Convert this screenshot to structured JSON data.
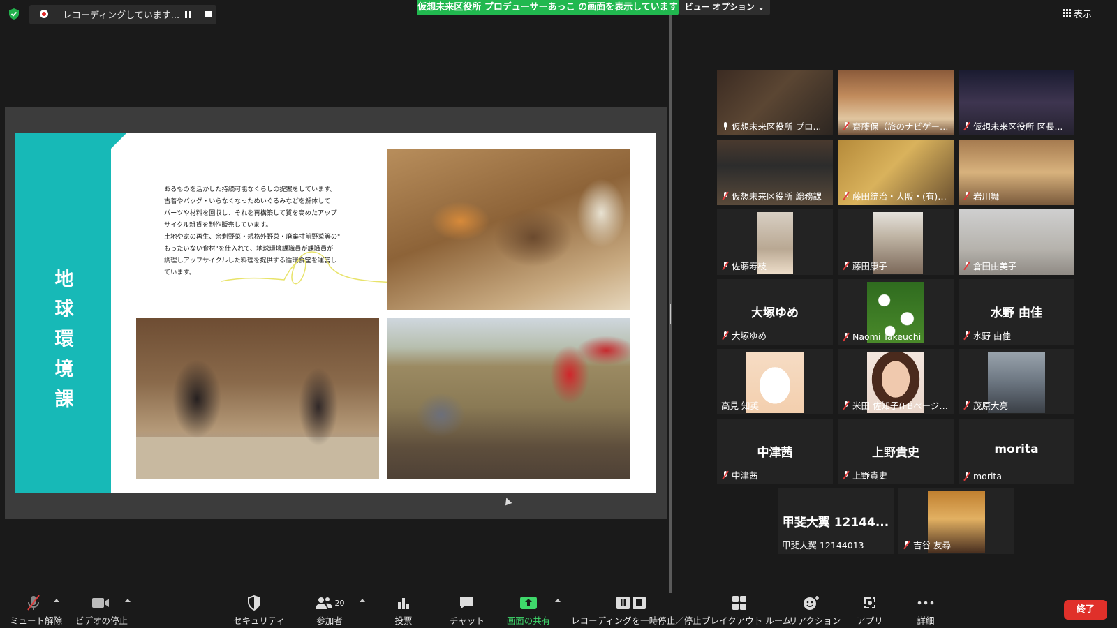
{
  "recording": {
    "status_text": "レコーディングしています..."
  },
  "share_banner": "仮想未来区役所 プロデューサーあっこ の画面を表示しています",
  "view_options": "ビュー オプション ⌄",
  "view_button": "表示",
  "slide": {
    "title": "地球環境課",
    "body": "あるものを活かした持続可能なくらしの提案をしています。\n古着やバッグ・いらなくなったぬいぐるみなどを解体して\nパーツや材料を回収し、それを再構築して質を高めたアップ\nサイクル雑貨を制作販売しています。\n土地や家の再生、余剰野菜・規格外野菜・廃棄寸前野菜等の\"\nもったいない食材\"を仕入れて、地球環境課職員が課職員が\n調理しアップサイクルした料理を提供する循環食堂を運営し\nています。",
    "accent_color": "#17b9b7"
  },
  "participants": [
    {
      "name": "仮想未来区役所 プロ...",
      "muted": false,
      "active": true,
      "video": true
    },
    {
      "name": "齋藤保（旅のナビゲータ...",
      "muted": true,
      "video": true
    },
    {
      "name": "仮想未来区役所 区長...",
      "muted": true,
      "video": true
    },
    {
      "name": "仮想未来区役所 総務課",
      "muted": true,
      "video": true
    },
    {
      "name": "藤田統治・大阪・(有)リア...",
      "muted": true,
      "video": true
    },
    {
      "name": "岩川舞",
      "muted": true,
      "video": true
    },
    {
      "name": "佐藤寿枝",
      "muted": true,
      "video": true
    },
    {
      "name": "藤田康子",
      "muted": true,
      "video": true
    },
    {
      "name": "倉田由美子",
      "muted": true,
      "video": true
    },
    {
      "name": "大塚ゆめ",
      "display": "大塚ゆめ",
      "muted": true,
      "video": false
    },
    {
      "name": "Naomi Takeuchi",
      "muted": true,
      "video": true
    },
    {
      "name": "水野 由佳",
      "display": "水野 由佳",
      "muted": true,
      "video": false
    },
    {
      "name": "高見 知英",
      "muted": false,
      "video": true
    },
    {
      "name": "米田 佐知子(FBページ「...",
      "muted": true,
      "video": true
    },
    {
      "name": "茂原大亮",
      "muted": true,
      "video": true
    },
    {
      "name": "中津茜",
      "display": "中津茜",
      "muted": true,
      "video": false
    },
    {
      "name": "上野貴史",
      "display": "上野貴史",
      "muted": true,
      "video": false
    },
    {
      "name": "morita",
      "display": "morita",
      "muted": true,
      "video": false
    },
    {
      "name": "甲斐大翼 12144013",
      "display": "甲斐大翼 12144...",
      "muted": false,
      "video": false
    },
    {
      "name": "吉谷 友尋",
      "muted": true,
      "video": true
    }
  ],
  "toolbar": {
    "mute": "ミュート解除",
    "video": "ビデオの停止",
    "security": "セキュリティ",
    "participants": "参加者",
    "participants_count": "20",
    "polls": "投票",
    "chat": "チャット",
    "share": "画面の共有",
    "recording": "レコーディングを一時停止／停止",
    "breakout": "ブレイクアウト ルーム",
    "reactions": "リアクション",
    "apps": "アプリ",
    "more": "詳細",
    "end": "終了"
  }
}
